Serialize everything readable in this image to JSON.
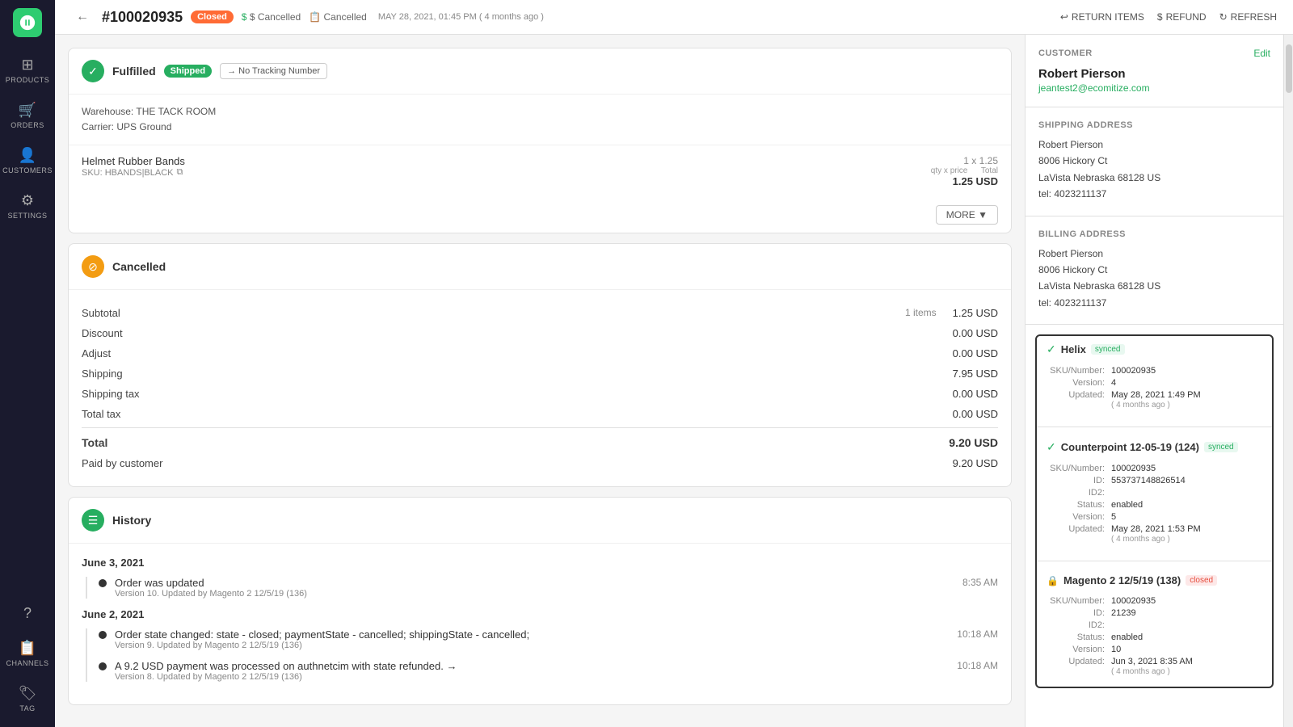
{
  "sidebar": {
    "logo_alt": "Logo",
    "items": [
      {
        "id": "products",
        "label": "Products",
        "icon": "⊞"
      },
      {
        "id": "orders",
        "label": "Orders",
        "icon": "🛒"
      },
      {
        "id": "customers",
        "label": "Customers",
        "icon": "👤"
      },
      {
        "id": "settings",
        "label": "Settings",
        "icon": "⚙"
      }
    ],
    "bottom_items": [
      {
        "id": "help",
        "label": "Help",
        "icon": "?"
      },
      {
        "id": "channels",
        "label": "Channels",
        "icon": "📋"
      },
      {
        "id": "tag",
        "label": "Tag",
        "icon": "🏷"
      }
    ]
  },
  "header": {
    "back_label": "←",
    "order_number": "#100020935",
    "badge_closed": "Closed",
    "badge_cancelled1": "$ Cancelled",
    "badge_cancelled2": "Cancelled",
    "order_date": "MAY 28, 2021, 01:45 PM",
    "order_date_relative": "( 4 months ago )",
    "actions": {
      "return_items": "RETURN ITEMS",
      "refund": "REFUND",
      "refresh": "REFRESH"
    }
  },
  "fulfilled_card": {
    "title": "Fulfilled",
    "badge_shipped": "Shipped",
    "tracking_btn": "→ No Tracking Number",
    "warehouse": "Warehouse: THE TACK ROOM",
    "carrier": "Carrier: UPS Ground",
    "line_items": [
      {
        "name": "Helmet Rubber Bands",
        "sku": "SKU: HBANDS|BLACK",
        "qty_price": "1 x 1.25",
        "price_label": "qty x price",
        "total": "1.25 USD",
        "total_label": "Total"
      }
    ],
    "more_btn": "MORE ▼"
  },
  "cancelled_card": {
    "title": "Cancelled",
    "subtotal_label": "Subtotal",
    "subtotal_items": "1 items",
    "subtotal_value": "1.25 USD",
    "discount_label": "Discount",
    "discount_value": "0.00 USD",
    "adjust_label": "Adjust",
    "adjust_value": "0.00 USD",
    "shipping_label": "Shipping",
    "shipping_value": "7.95 USD",
    "shipping_tax_label": "Shipping tax",
    "shipping_tax_value": "0.00 USD",
    "total_tax_label": "Total tax",
    "total_tax_value": "0.00 USD",
    "total_label": "Total",
    "total_value": "9.20 USD",
    "paid_label": "Paid by customer",
    "paid_value": "9.20 USD"
  },
  "history_card": {
    "title": "History",
    "groups": [
      {
        "date": "June 3, 2021",
        "events": [
          {
            "desc": "Order was updated",
            "sub": "Version 10. Updated by Magento 2 12/5/19 (136)",
            "time": "8:35 AM"
          }
        ]
      },
      {
        "date": "June 2, 2021",
        "events": [
          {
            "desc": "Order state changed: state - closed; paymentState - cancelled; shippingState - cancelled;",
            "sub": "Version 9. Updated by Magento 2 12/5/19 (136)",
            "time": "10:18 AM"
          },
          {
            "desc": "A 9.2 USD payment was processed on authnetcim with state refunded. →",
            "sub": "Version 8. Updated by Magento 2 12/5/19 (136)",
            "time": "10:18 AM"
          }
        ]
      }
    ]
  },
  "customer": {
    "section_title": "CUSTOMER",
    "edit_label": "Edit",
    "name": "Robert Pierson",
    "email": "jeantest2@ecomitize.com",
    "shipping_title": "SHIPPING ADDRESS",
    "shipping_name": "Robert Pierson",
    "shipping_address1": "8006 Hickory Ct",
    "shipping_city_state": "LaVista Nebraska 68128 US",
    "shipping_tel_label": "tel:",
    "shipping_tel": "4023211137",
    "billing_title": "BILLING ADDRESS",
    "billing_name": "Robert Pierson",
    "billing_address1": "8006 Hickory Ct",
    "billing_city_state": "LaVista Nebraska 68128 US",
    "billing_tel_label": "tel:",
    "billing_tel": "4023211137"
  },
  "sync_panel": {
    "helix": {
      "name": "Helix",
      "badge": "synced",
      "sku_label": "SKU/Number:",
      "sku_value": "100020935",
      "version_label": "Version:",
      "version_value": "4",
      "updated_label": "Updated:",
      "updated_value": "May 28, 2021 1:49 PM",
      "updated_relative": "( 4 months ago )"
    },
    "counterpoint": {
      "name": "Counterpoint 12-05-19 (124)",
      "badge": "synced",
      "sku_label": "SKU/Number:",
      "sku_value": "100020935",
      "id_label": "ID:",
      "id_value": "553737148826514",
      "id2_label": "ID2:",
      "id2_value": "",
      "status_label": "Status:",
      "status_value": "enabled",
      "version_label": "Version:",
      "version_value": "5",
      "updated_label": "Updated:",
      "updated_value": "May 28, 2021 1:53 PM",
      "updated_relative": "( 4 months ago )"
    },
    "magento": {
      "name": "Magento 2 12/5/19 (138)",
      "badge": "closed",
      "sku_label": "SKU/Number:",
      "sku_value": "100020935",
      "id_label": "ID:",
      "id_value": "21239",
      "id2_label": "ID2:",
      "id2_value": "",
      "status_label": "Status:",
      "status_value": "enabled",
      "version_label": "Version:",
      "version_value": "10",
      "updated_label": "Updated:",
      "updated_value": "Jun 3, 2021 8:35 AM",
      "updated_relative": "( 4 months ago )"
    }
  }
}
